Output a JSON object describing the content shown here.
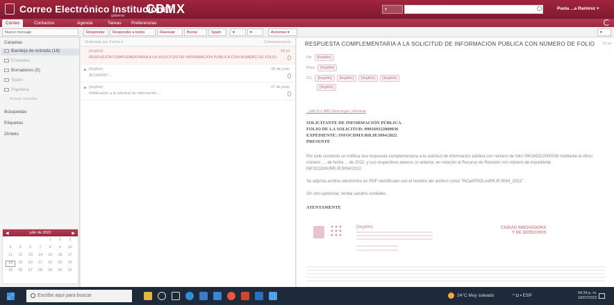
{
  "header": {
    "app_title": "Correo Electrónico Institucional",
    "brand": "CDMX",
    "brand_sub": "gobierno",
    "search_select": "▾",
    "user": "Paola ...a Ramirez ▾"
  },
  "app_tabs": [
    "Correo",
    "Contactos",
    "Agenda",
    "Tareas",
    "Preferencias"
  ],
  "toolbar": {
    "compose": "Nuevo mensaje",
    "reply": "Responder",
    "reply_all": "Responder a todos",
    "forward": "Reenviar",
    "delete": "Borrar",
    "spam": "Spam",
    "flag": "▾",
    "tag": "▾",
    "actions": "Acciones ▾",
    "view": "▾"
  },
  "sidebar": {
    "section_title": "Carpetas",
    "folders": [
      {
        "label": "Bandeja de entrada",
        "count": "(18)",
        "selected": true
      },
      {
        "label": "Enviados",
        "count": "",
        "selected": false
      },
      {
        "label": "Borradores",
        "count": "(5)",
        "selected": false
      },
      {
        "label": "Spam",
        "count": "",
        "selected": false
      },
      {
        "label": "Papelera",
        "count": "",
        "selected": false
      }
    ],
    "extra": "Buscar carpetas",
    "searches": "Búsquedas",
    "tags": "Etiquetas",
    "zimlets": "Zimlets"
  },
  "calendar": {
    "title": "julio de 2022",
    "cells": [
      "",
      "",
      "",
      "",
      "1",
      "2",
      "3",
      "4",
      "5",
      "6",
      "7",
      "8",
      "9",
      "10",
      "11",
      "12",
      "13",
      "14",
      "15",
      "16",
      "17",
      "18",
      "19",
      "20",
      "21",
      "22",
      "23",
      "24",
      "25",
      "26",
      "27",
      "28",
      "29",
      "30",
      "31"
    ]
  },
  "message_list": {
    "sort_label": "Ordenado por Fecha ▾",
    "count_label": "Conversaciones",
    "messages": [
      {
        "from": "[ilegible]",
        "date": "18 jul",
        "subject": "RESPUESTA COMPLEMENTARIA A LA SOLICITUD DE INFORMACIÓN PÚBLICA CON NÚMERO DE FOLIO",
        "selected": true
      },
      {
        "from": "[ilegible]",
        "date": "28 de junio",
        "subject": "ACUERDO ...",
        "selected": false
      },
      {
        "from": "[ilegible]",
        "date": "27 de junio",
        "subject": "Notificación a la solicitud de información ...",
        "selected": false
      }
    ]
  },
  "preview": {
    "title": "RESPUESTA COMPLEMENTARIA A LA SOLICITUD DE INFORMACIÓN PÚBLICA CON NÚMERO DE FOLIO 09",
    "date": "18 jul",
    "date2": "...",
    "from_label": "De:",
    "from_value": "[ilegible]",
    "to_label": "Para:",
    "to_value": "[ilegible]",
    "cc_label": "CC:",
    "cc_values": [
      "[ilegible]",
      "[ilegible]",
      "[ilegible]",
      "[ilegible]",
      "[ilegible]"
    ],
    "attachment": "...pdf (0.1 MB) Descargar | Eliminar",
    "body_heading": [
      "SOLICITANTE DE INFORMACIÓN PÚBLICA",
      "FOLIO DE LA SOLICITUD: 090169322000036",
      "EXPEDIENTE: INFOCDMX/RR.IP.3094/2022",
      "PRESENTE"
    ],
    "body_p1": "Por este conducto se notifica una respuesta complementaria a la solicitud de información pública con número de folio 090169322000036 mediante el oficio número ..., de fecha ... de 2022, y sus respectivos anexos, lo anterior, en relación al Recurso de Revisión con número de expediente INFOCDMX/RR.IP.3094/2022.",
    "body_p2": "Se adjunta archivo electrónico en PDF identificado con el nombre del archivo como \"RCarIPSOLsoRR.IP.3094_2022\".",
    "body_p3": "Sin otro particular, reciba saludos cordiales.",
    "closing": "ATENTAMENTE",
    "sig_name": "[ilegible]",
    "tagline": [
      "CIUDAD INNOVADORA",
      "Y DE DERECHOS"
    ]
  },
  "taskbar": {
    "search_placeholder": "Escribe aquí para buscar",
    "weather": "24°C Muy soleado",
    "tray": "^ ◘ ▪ ESP",
    "time": "04:34 p. m.",
    "date": "18/07/2022"
  },
  "colors": {
    "brand": "#8e1f37",
    "taskbar": "#1e2a3a",
    "accent_text": "#c27c8c"
  }
}
